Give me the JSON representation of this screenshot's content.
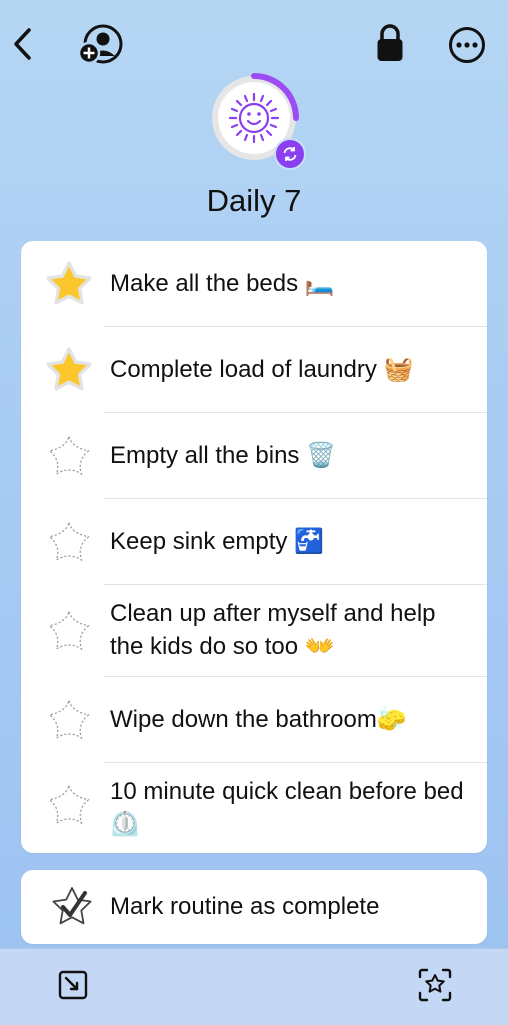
{
  "routine": {
    "title": "Daily 7"
  },
  "tasks": [
    {
      "label": "Make all the beds 🛏️",
      "done": true
    },
    {
      "label": "Complete load of laundry 🧺",
      "done": true
    },
    {
      "label": "Empty all the bins 🗑️",
      "done": false
    },
    {
      "label": "Keep sink empty 🚰",
      "done": false
    },
    {
      "label": "Clean up after myself and help the kids do so too 👐",
      "done": false
    },
    {
      "label": "Wipe down the bathroom🧽",
      "done": false
    },
    {
      "label": "10 minute quick clean before bed ⏲️",
      "done": false
    }
  ],
  "complete": {
    "label": "Mark routine as complete"
  },
  "colors": {
    "accent": "#8a3ff0",
    "star": "#fbc02d",
    "background": "#a9ccf3"
  },
  "icons": {
    "back": "chevron-left-icon",
    "add_user": "add-user-icon",
    "lock": "lock-icon",
    "more": "ellipsis-circle-icon",
    "routine": "sun-face-icon",
    "repeat": "repeat-icon",
    "tab_left": "square-arrow-icon",
    "tab_right": "star-scan-icon"
  }
}
